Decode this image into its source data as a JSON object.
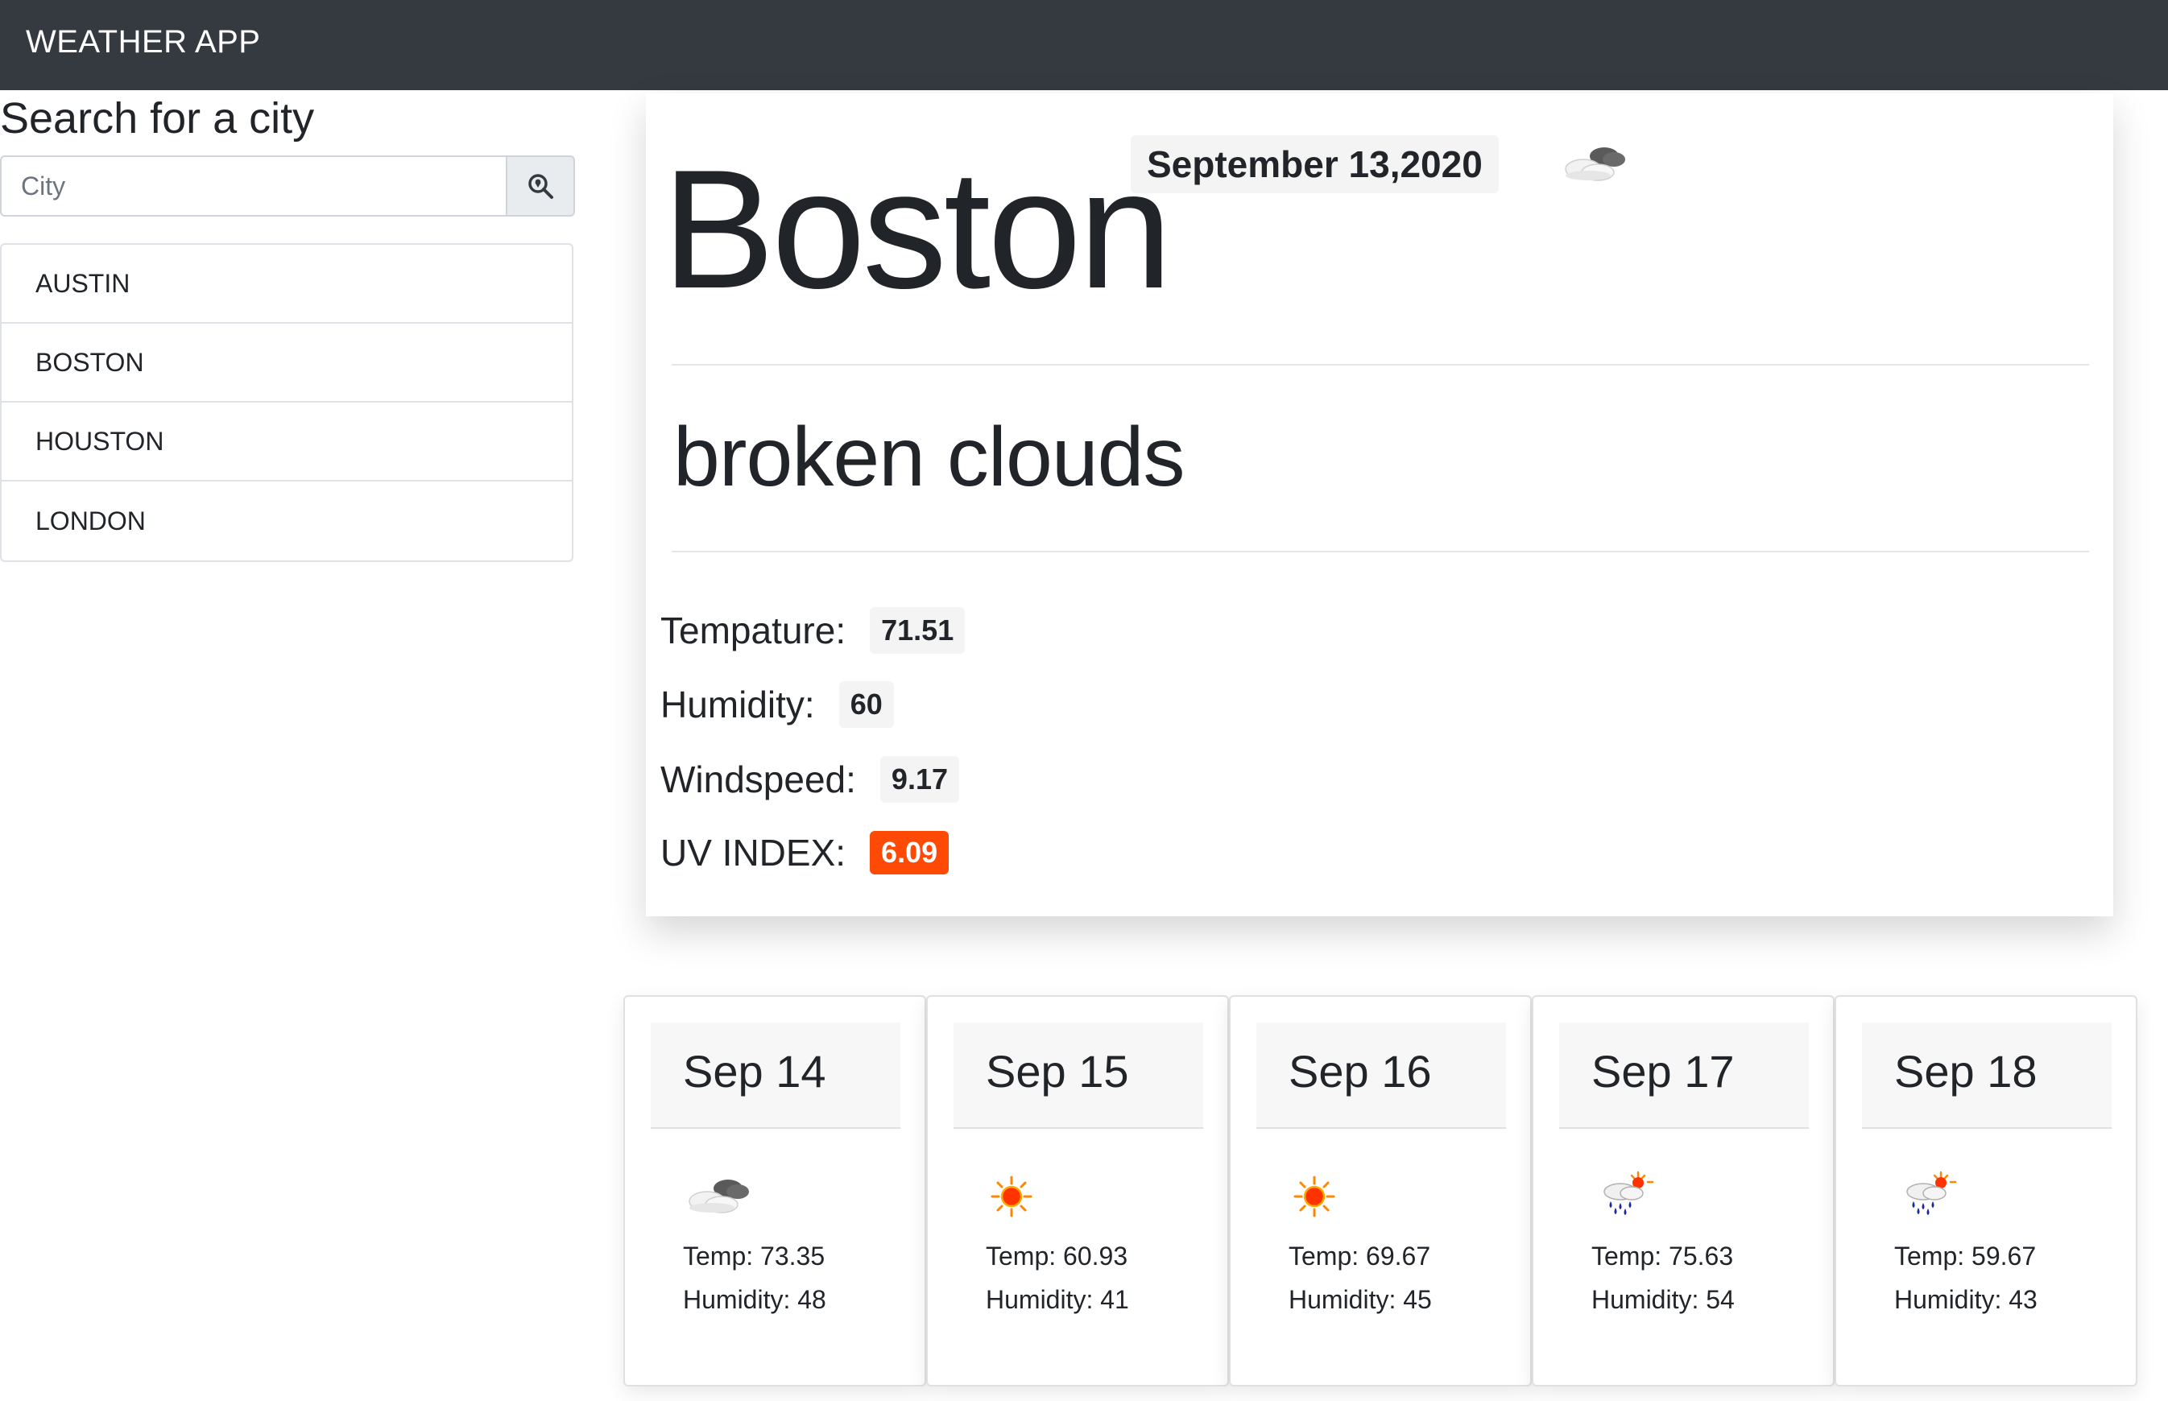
{
  "app": {
    "title": "WEATHER APP"
  },
  "search": {
    "heading": "Search for a city",
    "placeholder": "City",
    "button_icon": "search-location-icon"
  },
  "cities": [
    "AUSTIN",
    "BOSTON",
    "HOUSTON",
    "LONDON"
  ],
  "current": {
    "city": "Boston",
    "date": "September 13,2020",
    "icon": "broken-clouds-icon",
    "description": "broken clouds",
    "temperature_label": "Tempature:",
    "temperature": "71.51",
    "humidity_label": "Humidity:",
    "humidity": "60",
    "windspeed_label": "Windspeed:",
    "windspeed": "9.17",
    "uv_label": "UV INDEX:",
    "uv": "6.09"
  },
  "forecast": [
    {
      "date": "Sep 14",
      "icon": "broken-clouds-icon",
      "temp": "Temp: 73.35",
      "humidity": "Humidity: 48"
    },
    {
      "date": "Sep 15",
      "icon": "sun-icon",
      "temp": "Temp: 60.93",
      "humidity": "Humidity: 41"
    },
    {
      "date": "Sep 16",
      "icon": "sun-icon",
      "temp": "Temp: 69.67",
      "humidity": "Humidity: 45"
    },
    {
      "date": "Sep 17",
      "icon": "rain-sun-icon",
      "temp": "Temp: 75.63",
      "humidity": "Humidity: 54"
    },
    {
      "date": "Sep 18",
      "icon": "rain-sun-icon",
      "temp": "Temp: 59.67",
      "humidity": "Humidity: 43"
    }
  ],
  "colors": {
    "navbar": "#343a40",
    "uv_badge": "#ff4a06",
    "badge_bg": "#f4f4f4"
  }
}
